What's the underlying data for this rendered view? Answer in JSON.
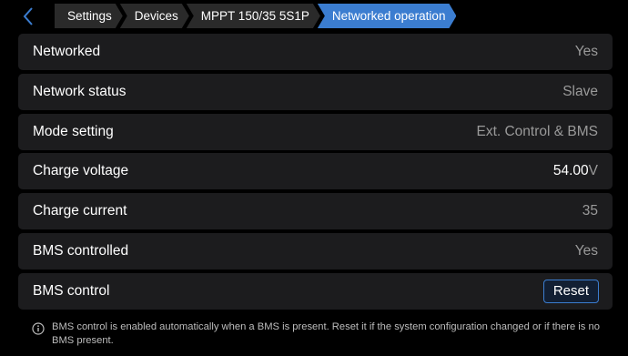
{
  "header": {
    "breadcrumbs": [
      {
        "label": "Settings"
      },
      {
        "label": "Devices"
      },
      {
        "label": "MPPT 150/35 5S1P"
      },
      {
        "label": "Networked operation"
      }
    ]
  },
  "settings": [
    {
      "label": "Networked",
      "value": "Yes"
    },
    {
      "label": "Network status",
      "value": "Slave"
    },
    {
      "label": "Mode setting",
      "value": "Ext. Control & BMS"
    },
    {
      "label": "Charge voltage",
      "value": "54.00",
      "unit": "V"
    },
    {
      "label": "Charge current",
      "value": "35"
    },
    {
      "label": "BMS controlled",
      "value": "Yes"
    },
    {
      "label": "BMS control",
      "button_label": "Reset"
    }
  ],
  "footer": {
    "note": "BMS control is enabled automatically when a BMS is present. Reset it if the system configuration changed or if there is no BMS present."
  },
  "colors": {
    "accent": "#3b7dd0",
    "row_background": "#1c1c1e",
    "value_text": "#9a9a9a"
  },
  "icons": {
    "back": "chevron-left-icon",
    "info": "info-icon"
  }
}
